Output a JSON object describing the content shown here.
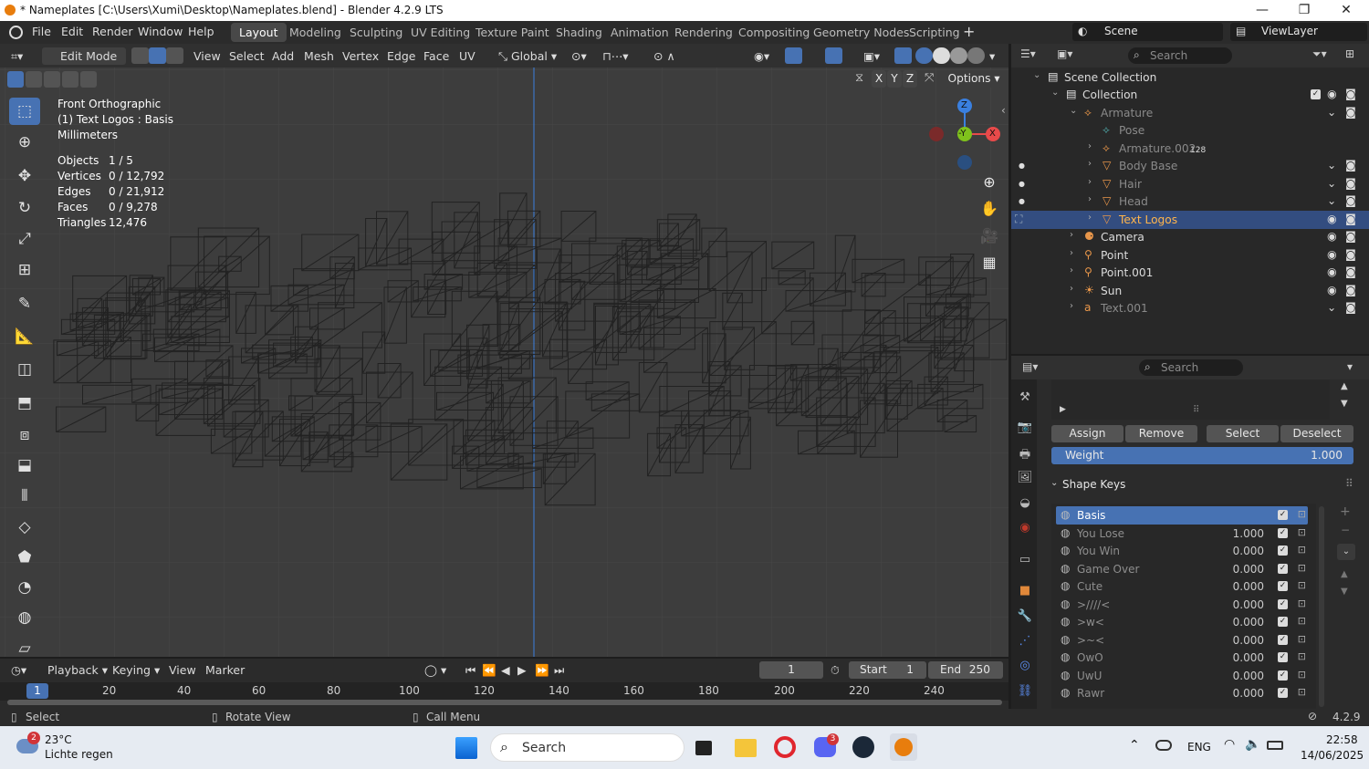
{
  "window": {
    "title": "* Nameplates [C:\\Users\\Xumi\\Desktop\\Nameplates.blend] - Blender 4.2.9 LTS",
    "minimize": "—",
    "maximize": "❐",
    "close": "✕"
  },
  "menu": [
    "File",
    "Edit",
    "Render",
    "Window",
    "Help"
  ],
  "workspaces": [
    "Layout",
    "Modeling",
    "Sculpting",
    "UV Editing",
    "Texture Paint",
    "Shading",
    "Animation",
    "Rendering",
    "Compositing",
    "Geometry Nodes",
    "Scripting"
  ],
  "active_workspace": "Layout",
  "scene": {
    "label": "Scene",
    "viewlayer": "ViewLayer"
  },
  "viewport_header": {
    "mode": "Edit Mode",
    "menus": [
      "View",
      "Select",
      "Add",
      "Mesh",
      "Vertex",
      "Edge",
      "Face",
      "UV"
    ],
    "transform": "Global",
    "options": "Options",
    "axes": [
      "X",
      "Y",
      "Z"
    ]
  },
  "overlay": {
    "view": "Front Orthographic",
    "object": "(1) Text Logos : Basis",
    "units": "Millimeters",
    "stats": [
      {
        "label": "Objects",
        "value": "1 / 5"
      },
      {
        "label": "Vertices",
        "value": "0 / 12,792"
      },
      {
        "label": "Edges",
        "value": "0 / 21,912"
      },
      {
        "label": "Faces",
        "value": "0 / 9,278"
      },
      {
        "label": "Triangles",
        "value": "12,476"
      }
    ]
  },
  "gizmo": {
    "z": "Z",
    "y": "-Y",
    "x": "X"
  },
  "timeline": {
    "menus": [
      "Playback",
      "Keying",
      "View",
      "Marker"
    ],
    "current_frame": "1",
    "start_label": "Start",
    "start": "1",
    "end_label": "End",
    "end": "250",
    "ticks": [
      "1",
      "20",
      "40",
      "60",
      "80",
      "100",
      "120",
      "140",
      "160",
      "180",
      "200",
      "220",
      "240"
    ]
  },
  "status": {
    "select": "Select",
    "rotate": "Rotate View",
    "menu": "Call Menu",
    "version": "4.2.9"
  },
  "outliner": {
    "search_placeholder": "Search",
    "rows": [
      {
        "label": "Scene Collection",
        "icon": "collection-icon"
      },
      {
        "label": "Collection",
        "icon": "collection-icon"
      },
      {
        "label": "Armature",
        "icon": "armature-icon",
        "dim": true
      },
      {
        "label": "Pose",
        "icon": "pose-icon",
        "dim": true
      },
      {
        "label": "Armature.002",
        "icon": "armature-icon",
        "dim": true,
        "badge": "128"
      },
      {
        "label": "Body Base",
        "icon": "mesh-icon",
        "dim": true
      },
      {
        "label": "Hair",
        "icon": "mesh-icon",
        "dim": true
      },
      {
        "label": "Head",
        "icon": "mesh-icon",
        "dim": true
      },
      {
        "label": "Text Logos",
        "icon": "mesh-icon",
        "selected": true
      },
      {
        "label": "Camera",
        "icon": "camera-icon"
      },
      {
        "label": "Point",
        "icon": "light-icon"
      },
      {
        "label": "Point.001",
        "icon": "light-icon"
      },
      {
        "label": "Sun",
        "icon": "sun-icon"
      },
      {
        "label": "Text.001",
        "icon": "text-icon",
        "dim": true
      }
    ]
  },
  "properties": {
    "search_placeholder": "Search",
    "buttons": [
      "Assign",
      "Remove",
      "Select",
      "Deselect"
    ],
    "weight_label": "Weight",
    "weight_value": "1.000",
    "shape_keys_title": "Shape Keys",
    "shape_keys": [
      {
        "name": "Basis",
        "value": ""
      },
      {
        "name": "You Lose",
        "value": "1.000"
      },
      {
        "name": "You Win",
        "value": "0.000"
      },
      {
        "name": "Game Over",
        "value": "0.000"
      },
      {
        "name": "Cute",
        "value": "0.000"
      },
      {
        "name": ">////<",
        "value": "0.000"
      },
      {
        "name": ">w<",
        "value": "0.000"
      },
      {
        "name": ">~<",
        "value": "0.000"
      },
      {
        "name": "OwO",
        "value": "0.000"
      },
      {
        "name": "UwU",
        "value": "0.000"
      },
      {
        "name": "Rawr",
        "value": "0.000"
      }
    ]
  },
  "taskbar": {
    "weather_temp": "23°C",
    "weather_desc": "Lichte regen",
    "weather_badge": "2",
    "search": "Search",
    "discord_badge": "3",
    "lang": "ENG",
    "time": "22:58",
    "date": "14/06/2025"
  },
  "colors": {
    "accent": "#4772b3",
    "selected_row": "#334d80",
    "viewport_bg": "#3d3d3d",
    "axis_x": "#e84a4a",
    "axis_y": "#7fc21c",
    "axis_z": "#3a80e0"
  }
}
